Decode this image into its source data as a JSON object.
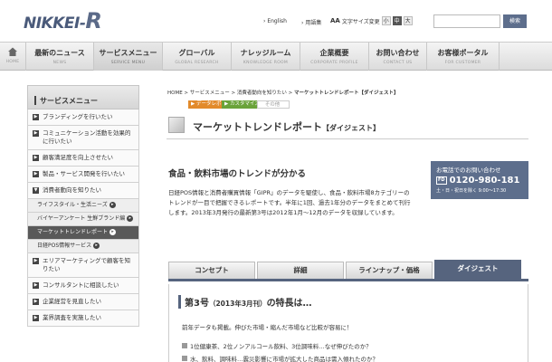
{
  "header": {
    "logo_text": "NIKKEI-",
    "logo_r": "R",
    "english_link": "English",
    "glossary_link": "用語集",
    "font_size_label": "文字サイズ変更",
    "font_sizes": [
      "小",
      "中",
      "大"
    ],
    "search_placeholder": "",
    "search_button": "検索"
  },
  "gnav": [
    {
      "jp": "",
      "en": "HOME"
    },
    {
      "jp": "最新のニュース",
      "en": "NEWS"
    },
    {
      "jp": "サービスメニュー",
      "en": "SERVICE MENU"
    },
    {
      "jp": "グローバル",
      "en": "GLOBAL RESEARCH"
    },
    {
      "jp": "ナレッジルーム",
      "en": "KNOWLEDGE ROOM"
    },
    {
      "jp": "企業概要",
      "en": "CORPORATE PROFILE"
    },
    {
      "jp": "お問い合わせ",
      "en": "CONTACT US"
    },
    {
      "jp": "お客様ポータル",
      "en": "FOR CUSTOMER"
    }
  ],
  "sidebar": {
    "title": "サービスメニュー",
    "items": [
      "ブランディングを行いたい",
      "コミュニケーション活動を効果的に行いたい",
      "顧客満足度を向上させたい",
      "製品・サービス開発を行いたい",
      "消費者動向を知りたい"
    ],
    "subitems": [
      "ライフスタイル・生活ニーズ",
      "バイヤーアンケート 生鮮ブランド編",
      "マーケットトレンドレポート",
      "日経POS情報サービス"
    ],
    "items_after": [
      "エリアマーケティングで顧客を知りたい",
      "コンサルタントに相談したい",
      "企業経営を見直したい",
      "業界調査を実施したい"
    ]
  },
  "breadcrumb": {
    "parts": "HOME > サービスメニュー > 消費者動向を知りたい > ",
    "current": "マーケットトレンドレポート【ダイジェスト】"
  },
  "tags": {
    "data": "データレポート",
    "custom": "カスタマイズ",
    "other": "その他"
  },
  "page": {
    "title": "マーケットトレンドレポート",
    "title_sub": "【ダイジェスト】",
    "headline": "食品・飲料市場のトレンドが分かる",
    "description": "日経POS情報と消費者購買情報「GIPR」のデータを駆使し、食品・飲料市場8カテゴリーのトレンドが一目で把握できるレポートです。半年に1回、過去1年分のデータをまとめて刊行します。2013年3月発行の最新第3号は2012年1月〜12月のデータを収録しています。"
  },
  "contact": {
    "label": "お電話でのお問い合わせ",
    "free_dial": "FD",
    "phone": "0120-980-181",
    "hours": "土・日・祝日を除く 9:00〜17:30"
  },
  "tabs": [
    "コンセプト",
    "詳細",
    "ラインナップ・価格",
    "ダイジェスト"
  ],
  "issue": {
    "title": "第3号",
    "title_paren": "（2013年3月刊）",
    "title_rest": "の特長は…",
    "lead": "前年データも掲載。伸びた市場・縮んだ市場など比較が容易に！",
    "bullets": [
      "1位健康茶、2位ノンアルコール飲料、3位調味料…なぜ伸びたのか？",
      "水、飲料、調味料…震災影響に市場が拡大した商品は需入傾れたのか？"
    ]
  }
}
